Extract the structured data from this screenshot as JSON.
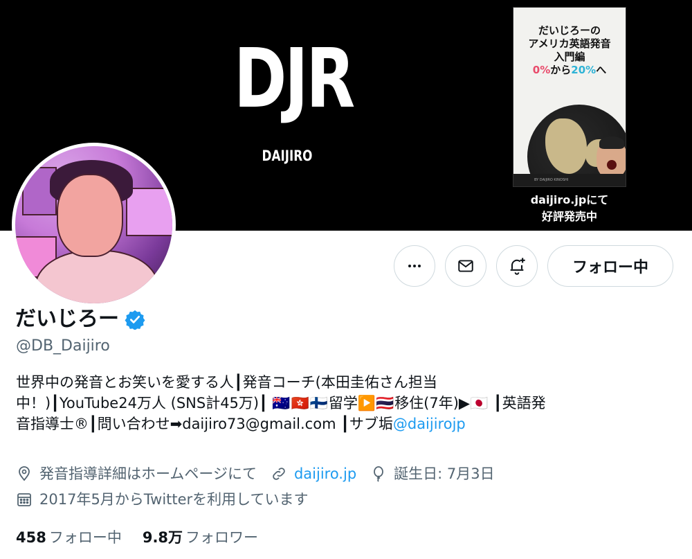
{
  "banner": {
    "logo": "DJR",
    "sub": "DAIJIRO",
    "book": {
      "title_line1": "だいじろーの",
      "title_line2": "アメリカ英語発音",
      "title_line3": "入門編",
      "title_pct_a": "0%",
      "title_kara": "から",
      "title_pct_b": "20%",
      "title_he": "へ",
      "footer": "BY DAIJIRO KINOSHI"
    },
    "promo_line1": "daijiro.jpにて",
    "promo_line2": "好評発売中"
  },
  "actions": {
    "more_icon": "more-icon",
    "message_icon": "envelope-icon",
    "notify_icon": "bell-plus-icon",
    "follow_label": "フォロー中"
  },
  "profile": {
    "display_name": "だいじろー",
    "verified_icon": "verified-badge-icon",
    "handle": "@DB_Daijiro",
    "bio_line1": "世界中の発音とお笑いを愛する人┃発音コーチ(本田圭佑さん担当",
    "bio_line2_a": "中！)┃YouTube24万人 (SNS計45万)┃ ",
    "bio_flags_a": "🇦🇺🇭🇰🇫🇮",
    "bio_line2_b": "留学",
    "bio_play": "▶️",
    "bio_flags_b": "🇹🇭",
    "bio_line2_c": "移住(7年)▶",
    "bio_flag_jp": "🇯🇵",
    "bio_line2_d": " ┃英語発",
    "bio_line3_a": "音指導士®┃問い合わせ➡daijiro73@gmail.com ┃サブ垢",
    "bio_mention": "@daijirojp",
    "location": "発音指導詳細はホームページにて",
    "website": "daijiro.jp",
    "birthday": "誕生日: 7月3日",
    "joined": "2017年5月からTwitterを利用しています"
  },
  "stats": {
    "following_count": "458",
    "following_label": "フォロー中",
    "followers_count": "9.8万",
    "followers_label": "フォロワー"
  },
  "colors": {
    "accent": "#1d9bf0",
    "muted": "#536471",
    "text": "#0f1419",
    "border": "#cfd9de"
  }
}
